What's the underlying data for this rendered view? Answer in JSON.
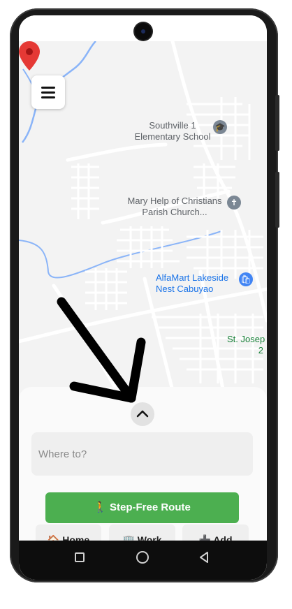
{
  "map": {
    "labels": {
      "school_line1": "Southville 1",
      "school_line2": "Elementary School",
      "church_line1": "Mary Help of Christians",
      "church_line2": "Parish Church...",
      "store_line1": "AlfaMart Lakeside",
      "store_line2": "Nest Cabuyao",
      "stjoseph": "St. Josep",
      "stjoseph_2": "2"
    },
    "icons": {
      "school": "graduation-cap-icon",
      "church": "cross-icon",
      "store": "shopping-icon",
      "location": "location-pin-icon"
    },
    "colors": {
      "water": "#8ab4f8",
      "pin": "#e53935",
      "poi_text": "#1a73e8"
    }
  },
  "menu": {
    "icon": "hamburger-menu-icon"
  },
  "sheet": {
    "handle_icon": "chevron-up-icon",
    "search_placeholder": "Where to?",
    "route_button": "🚶 Step-Free Route",
    "route_color": "#4caf50",
    "quick_actions": [
      {
        "label": "🏠 Home"
      },
      {
        "label": "🏢 Work"
      },
      {
        "label": "➕ Add"
      }
    ]
  },
  "navbar": {
    "icons": [
      "recent-apps-icon",
      "home-icon",
      "back-icon"
    ]
  }
}
